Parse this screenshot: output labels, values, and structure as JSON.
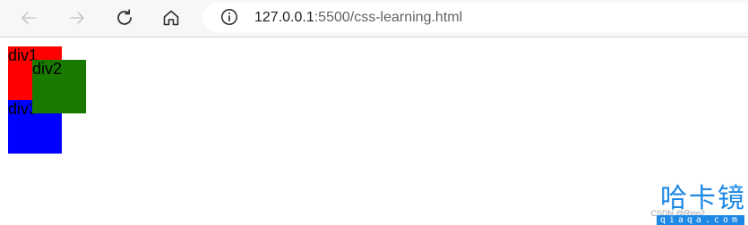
{
  "browser": {
    "address_bar": {
      "url_host": "127.0.0.1",
      "url_path": ":5500/css-learning.html"
    },
    "icons": {
      "back": "back-arrow-icon",
      "forward": "forward-arrow-icon",
      "refresh": "refresh-icon",
      "home": "home-icon",
      "site_info": "info-icon"
    }
  },
  "page": {
    "boxes": [
      {
        "label": "div1",
        "color": "#ff0000"
      },
      {
        "label": "div3",
        "color": "#0000ff"
      },
      {
        "label": "div2",
        "color": "#1a7a00"
      }
    ]
  },
  "watermark": {
    "logo": "哈卡镜",
    "domain": "qiaqa.com",
    "csdn": "CSDN @Ring2"
  }
}
